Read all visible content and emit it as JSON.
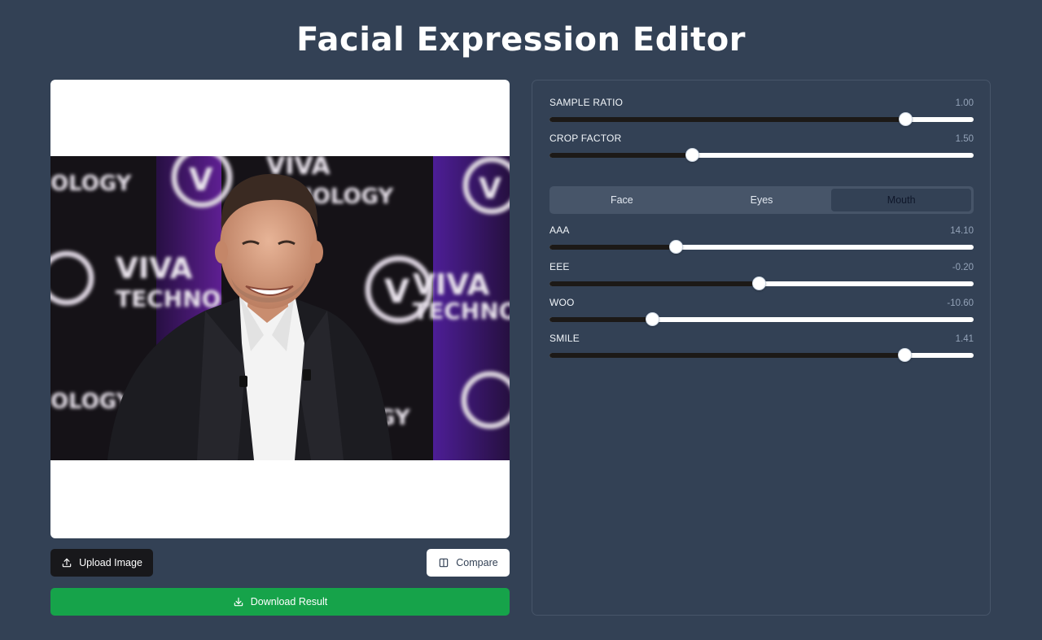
{
  "page": {
    "title": "Facial Expression Editor"
  },
  "image": {
    "alt": "Portrait photo"
  },
  "buttons": {
    "upload_label": "Upload Image",
    "compare_label": "Compare",
    "download_label": "Download Result"
  },
  "icons": {
    "upload": "upload-icon",
    "compare": "compare-icon",
    "download": "download-icon"
  },
  "global_sliders": [
    {
      "label": "SAMPLE RATIO",
      "value": "1.00",
      "fraction": 0.84
    },
    {
      "label": "CROP FACTOR",
      "value": "1.50",
      "fraction": 0.337
    }
  ],
  "tabs": [
    {
      "label": "Face",
      "active": false
    },
    {
      "label": "Eyes",
      "active": false
    },
    {
      "label": "Mouth",
      "active": true
    }
  ],
  "expression_sliders": [
    {
      "label": "AAA",
      "value": "14.10",
      "fraction": 0.299
    },
    {
      "label": "EEE",
      "value": "-0.20",
      "fraction": 0.494
    },
    {
      "label": "WOO",
      "value": "-10.60",
      "fraction": 0.242
    },
    {
      "label": "SMILE",
      "value": "1.41",
      "fraction": 0.838
    }
  ],
  "colors": {
    "background": "#334155",
    "upload_button": "#18181b",
    "download_button": "#16a34a",
    "slider_fill": "#1c1917"
  }
}
